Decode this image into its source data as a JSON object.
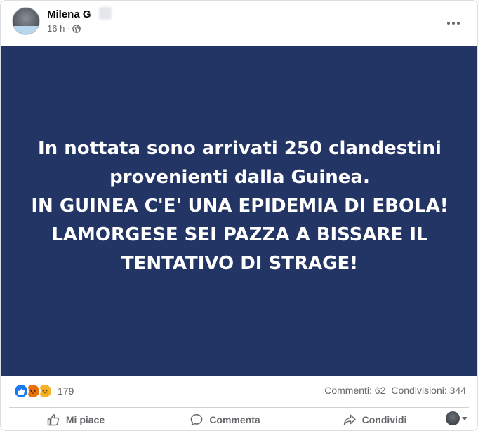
{
  "post": {
    "author": "Milena G",
    "time": "16 h",
    "separator": "·",
    "privacy_icon": "globe-icon",
    "menu_icon": "more-options-icon"
  },
  "image_text": {
    "lines": [
      "In nottata sono arrivati 250 clandestini",
      "provenienti dalla Guinea.",
      "IN GUINEA C'E' UNA EPIDEMIA DI EBOLA!",
      "LAMORGESE SEI PAZZA A BISSARE IL",
      "TENTATIVO DI STRAGE!"
    ],
    "background": "#233564",
    "color": "#ffffff"
  },
  "stats": {
    "reactions": [
      "like-icon",
      "angry-icon",
      "sad-icon"
    ],
    "reaction_count": "179",
    "comments": "Commenti: 62",
    "shares": "Condivisioni: 344"
  },
  "actions": {
    "like": "Mi piace",
    "comment": "Commenta",
    "share": "Condividi"
  },
  "colors": {
    "like_blue": "#1877f2",
    "angry_orange": "#e9710f",
    "sad_yellow": "#f7b125",
    "secondary_text": "#65676b"
  }
}
